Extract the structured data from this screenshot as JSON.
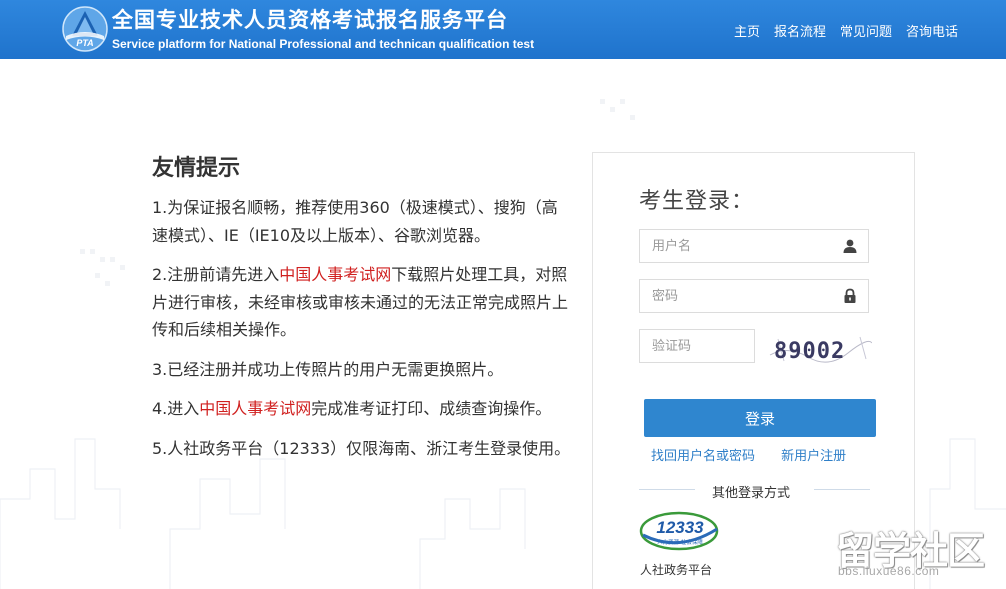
{
  "header": {
    "logo_text": "PTA",
    "title_cn": "全国专业技术人员资格考试报名服务平台",
    "title_en": "Service platform for National Professional and technican qualification test",
    "nav": [
      "主页",
      "报名流程",
      "常见问题",
      "咨询电话"
    ]
  },
  "tips": {
    "heading": "友情提示",
    "item1": "1.为保证报名顺畅，推荐使用360（极速模式）、搜狗（高速模式）、IE（IE10及以上版本）、谷歌浏览器。",
    "item2_before": "2.注册前请先进入",
    "item2_link": "中国人事考试网",
    "item2_after": "下载照片处理工具，对照片进行审核，未经审核或审核未通过的无法正常完成照片上传和后续相关操作。",
    "item3": "3.已经注册并成功上传照片的用户无需更换照片。",
    "item4_before": "4.进入",
    "item4_link": "中国人事考试网",
    "item4_after": "完成准考证打印、成绩查询操作。",
    "item5": "5.人社政务平台（12333）仅限海南、浙江考生登录使用。"
  },
  "login": {
    "heading": "考生登录：",
    "username_placeholder": "用户名",
    "password_placeholder": "密码",
    "captcha_placeholder": "验证码",
    "captcha_code": "89002",
    "submit_label": "登录",
    "recover_link": "找回用户名或密码",
    "register_link": "新用户注册",
    "other_label": "其他登录方式",
    "platform_badge": "12333",
    "platform_badge_sub": "人力资源 社会保障",
    "platform_label": "人社政务平台"
  },
  "watermark": {
    "main": "留学社区",
    "sub": "bbs.liuxue86.com"
  },
  "colors": {
    "header": "#2b80d6",
    "button": "#2f86cf",
    "link": "#2f7fc8",
    "highlight": "#d0201f"
  }
}
